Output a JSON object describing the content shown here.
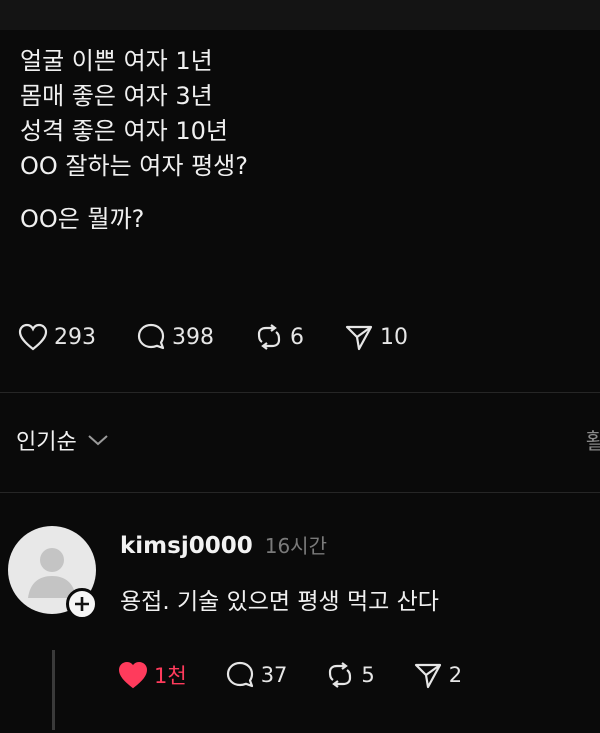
{
  "post": {
    "lines": [
      "얼굴 이쁜 여자 1년",
      "몸매 좋은 여자 3년",
      "성격 좋은 여자 10년",
      "OO 잘하는 여자 평생?"
    ],
    "question": "OO은 뭘까?",
    "stats": {
      "likes": "293",
      "comments": "398",
      "reposts": "6",
      "shares": "10"
    }
  },
  "sort": {
    "label": "인기순"
  },
  "edge_glyph": "활",
  "comment": {
    "username": "kimsj0000",
    "time": "16시간",
    "text": "용접. 기술 있으면 평생 먹고 산다",
    "stats": {
      "likes": "1천",
      "comments": "37",
      "reposts": "5",
      "shares": "2"
    }
  },
  "icons": [
    "heart-icon",
    "comment-icon",
    "repost-icon",
    "share-icon",
    "chevron-down-icon",
    "avatar-placeholder-icon",
    "follow-plus-icon"
  ],
  "colors": {
    "background": "#0a0a0a",
    "text": "#f2f2f2",
    "muted": "#7a7a7a",
    "liked": "#ff3b5c"
  }
}
